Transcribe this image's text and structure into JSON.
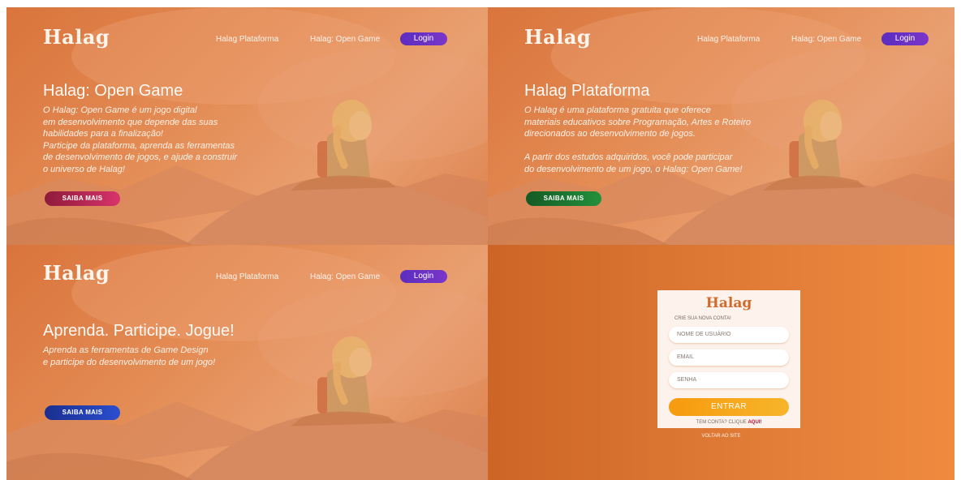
{
  "brand": "Halag",
  "nav": {
    "link1": "Halag Plataforma",
    "link2": "Halag: Open Game",
    "login": "Login"
  },
  "slides": [
    {
      "title": "Halag: Open Game",
      "lines": [
        "O Halag: Open Game é um jogo digital",
        "em desenvolvimento que depende das suas",
        "habilidades para a finalização!",
        "Participe da plataforma, aprenda as ferramentas",
        "de desenvolvimento de jogos, e ajude a construir",
        "o universo de Halag!"
      ],
      "cta": "SAIBA MAIS",
      "cta_color": "#c2185b"
    },
    {
      "title": "Halag Plataforma",
      "lines": [
        "O Halag é uma plataforma gratuita que oferece",
        "materiais educativos sobre Programação, Artes e Roteiro",
        "direcionados ao desenvolvimento de jogos.",
        "",
        "A partir dos estudos adquiridos, você pode participar",
        "do desenvolvimento de um jogo, o Halag: Open Game!"
      ],
      "cta": "SAIBA MAIS",
      "cta_color": "#1b7a2e"
    },
    {
      "title": "Aprenda. Participe. Jogue!",
      "lines": [
        "Aprenda as ferramentas de Game Design",
        "e participe do desenvolvimento de um jogo!"
      ],
      "cta": "SAIBA MAIS",
      "cta_color": "#1f3ea8"
    }
  ],
  "signup": {
    "logo": "Halag",
    "subtitle": "CRIE SUA NOVA CONTA!",
    "username_placeholder": "NOME DE USUÁRIO",
    "email_placeholder": "EMAIL",
    "password_placeholder": "SENHA",
    "submit": "ENTRAR",
    "have_account": "TEM CONTA? CLIQUE ",
    "here_link": "AQUI!",
    "back": "VOLTAR AO SITE"
  }
}
